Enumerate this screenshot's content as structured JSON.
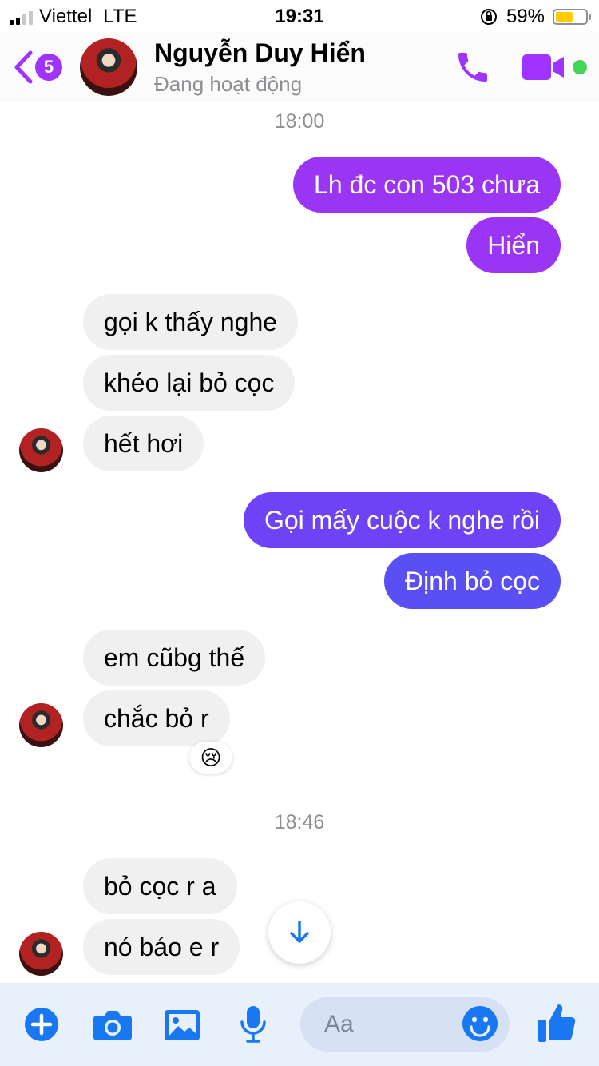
{
  "status_bar": {
    "carrier": "Viettel",
    "network": "LTE",
    "time": "19:31",
    "battery_percent": "59%",
    "battery_level": 0.59
  },
  "header": {
    "back_badge": "5",
    "contact_name": "Nguyễn Duy Hiển",
    "contact_status": "Đang hoạt động",
    "online": true
  },
  "chat": {
    "timestamps": [
      "18:00",
      "18:46"
    ],
    "messages": [
      {
        "dir": "out",
        "text": "Lh đc con 503 chưa",
        "color": "#9b35f4"
      },
      {
        "dir": "out",
        "text": "Hiển",
        "color": "#9b35f4"
      },
      {
        "dir": "in",
        "text": "gọi k thấy nghe"
      },
      {
        "dir": "in",
        "text": "khéo lại bỏ cọc"
      },
      {
        "dir": "in",
        "text": "hết hơi"
      },
      {
        "dir": "out",
        "text": "Gọi mấy cuộc k nghe rồi",
        "color": "#6e42f5"
      },
      {
        "dir": "out",
        "text": "Định bỏ cọc",
        "color": "#5a4ff3"
      },
      {
        "dir": "in",
        "text": "em cũbg thế"
      },
      {
        "dir": "in",
        "text": "chắc bỏ r"
      },
      {
        "dir": "in",
        "text": "bỏ cọc r a"
      },
      {
        "dir": "in",
        "text": "nó báo e r"
      }
    ],
    "reaction": "😢"
  },
  "composer": {
    "placeholder": "Aa"
  },
  "colors": {
    "accent": "#a033ff",
    "composer_icon": "#1977f2",
    "online": "#42d657"
  }
}
